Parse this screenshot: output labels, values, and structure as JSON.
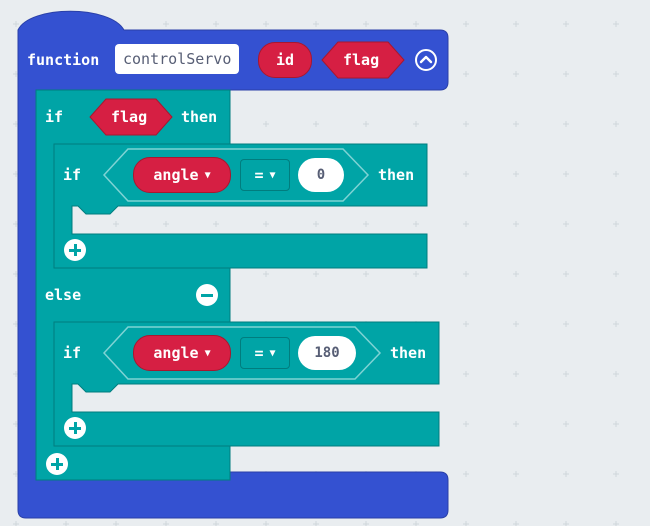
{
  "function_block": {
    "keyword": "function",
    "name": "controlServo",
    "params": [
      "id",
      "flag"
    ],
    "collapse_icon": "chevron-up-circle-icon"
  },
  "outer_if": {
    "if_label": "if",
    "condition": "flag",
    "then_label": "then",
    "else_label": "else",
    "remove_else_icon": "minus-circle-icon",
    "add_icon": "plus-circle-icon"
  },
  "inner_if_1": {
    "if_label": "if",
    "variable": "angle",
    "operator": "=",
    "value": "0",
    "then_label": "then",
    "add_icon": "plus-circle-icon"
  },
  "inner_if_2": {
    "if_label": "if",
    "variable": "angle",
    "operator": "=",
    "value": "180",
    "then_label": "then",
    "add_icon": "plus-circle-icon"
  },
  "colors": {
    "function_block": "#3451d1",
    "logic_block": "#00a4a6",
    "variable_reporter": "#d61f43",
    "workspace": "#e9edf0"
  }
}
